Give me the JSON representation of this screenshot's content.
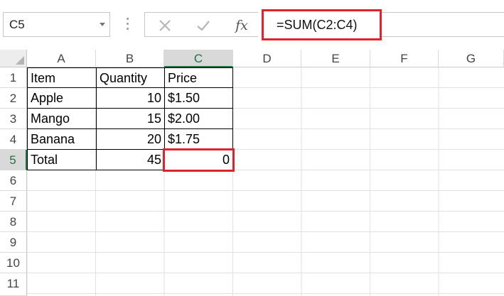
{
  "name_box": {
    "value": "C5"
  },
  "formula_bar": {
    "cancel_icon": "close-icon",
    "enter_icon": "check-icon",
    "fx_label": "fx",
    "formula": "=SUM(C2:C4)"
  },
  "columns": [
    "A",
    "B",
    "C",
    "D",
    "E",
    "F",
    "G"
  ],
  "rows": [
    "1",
    "2",
    "3",
    "4",
    "5",
    "6",
    "7",
    "8",
    "9",
    "10",
    "11"
  ],
  "active_cell": "C5",
  "table": {
    "r1": {
      "a": "Item",
      "b": "Quantity",
      "c": "Price"
    },
    "r2": {
      "a": "Apple",
      "b": "10",
      "c": "$1.50"
    },
    "r3": {
      "a": "Mango",
      "b": "15",
      "c": "$2.00"
    },
    "r4": {
      "a": "Banana",
      "b": "20",
      "c": "$1.75"
    },
    "r5": {
      "a": "Total",
      "b": "45",
      "c": "0"
    }
  },
  "colors": {
    "highlight": "#e0232b",
    "excel_green": "#217346"
  }
}
